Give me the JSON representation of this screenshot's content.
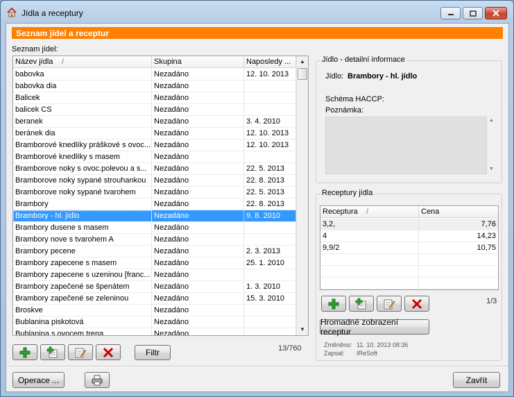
{
  "window": {
    "title": "Jídla a receptury",
    "colors": {
      "accent": "#ff8000",
      "selection": "#3399ff",
      "delete": "#cc0000",
      "add": "#2ea02e"
    }
  },
  "header": {
    "title": "Seznam jídel a receptur"
  },
  "food_list": {
    "label": "Seznam jídel:",
    "columns": [
      "Název jídla",
      "Skupina",
      "Naposledy ..."
    ],
    "rows": [
      [
        "babovka",
        "Nezadáno",
        "12. 10. 2013"
      ],
      [
        "babovka dia",
        "Nezadáno",
        ""
      ],
      [
        "Balicek",
        "Nezadáno",
        ""
      ],
      [
        "balicek CS",
        "Nezadáno",
        ""
      ],
      [
        "beranek",
        "Nezadáno",
        "3. 4. 2010"
      ],
      [
        "beránek dia",
        "Nezadáno",
        "12. 10. 2013"
      ],
      [
        "Bramborové knedlíky práškové s ovoc...",
        "Nezadáno",
        "12. 10. 2013"
      ],
      [
        "Bramborové knedlíky s masem",
        "Nezadáno",
        ""
      ],
      [
        "Bramborove noky  s ovoc.polevou a s...",
        "Nezadáno",
        "22. 5. 2013"
      ],
      [
        "Bramborove noky sypané strouhankou",
        "Nezadáno",
        "22. 8. 2013"
      ],
      [
        "Bramborove noky sypané tvarohem",
        "Nezadáno",
        "22. 5. 2013"
      ],
      [
        "Brambory",
        "Nezadáno",
        "22. 8. 2013"
      ],
      [
        "Brambory - hl. jídlo",
        "Nezadáno",
        "9. 8. 2010"
      ],
      [
        "Brambory dusene s masem",
        "Nezadáno",
        ""
      ],
      [
        "Brambory nove s tvarohem A",
        "Nezadáno",
        ""
      ],
      [
        "Brambory pecene",
        "Nezadáno",
        "2. 3. 2013"
      ],
      [
        "Brambory zapecene s masem",
        "Nezadáno",
        "25. 1. 2010"
      ],
      [
        "Brambory zapecene s uzeninou [franc...",
        "Nezadáno",
        ""
      ],
      [
        "Brambory zapečené se špenátem",
        "Nezadáno",
        "1. 3. 2010"
      ],
      [
        "Brambory zapečené se zeleninou",
        "Nezadáno",
        "15. 3. 2010"
      ],
      [
        "Broskve",
        "Nezadáno",
        ""
      ],
      [
        "Bublanina piskotová",
        "Nezadáno",
        ""
      ],
      [
        "Bublanina s ovocem trena",
        "Nezadáno",
        ""
      ]
    ],
    "selected_index": 12,
    "counter": "13/760",
    "filter_label": "Filtr"
  },
  "detail": {
    "group_title": "Jídlo - detailní informace",
    "food_label": "Jídlo:",
    "food_value": "Brambory - hl. jídlo",
    "haccp_label": "Schéma HACCP:",
    "note_label": "Poznámka:"
  },
  "recipes": {
    "group_title": "Receptury jídla",
    "columns": [
      "Receptura",
      "Cena"
    ],
    "rows": [
      [
        "3,2,",
        "7,76"
      ],
      [
        "4",
        "14,23"
      ],
      [
        "9,9/2",
        "10,75"
      ]
    ],
    "counter": "1/3",
    "bulk_button": "Hromadné zobrazení receptur",
    "changed_label": "Změněno:",
    "changed_value": "11. 10. 2013 08:36",
    "author_label": "Zapsal:",
    "author_value": "IReSoft"
  },
  "footer": {
    "operations_label": "Operace ...",
    "close_label": "Zavřít"
  },
  "icons": [
    "add-icon",
    "add-copy-icon",
    "edit-icon",
    "delete-icon",
    "printer-icon",
    "minimize-icon",
    "maximize-icon",
    "close-icon",
    "sort-arrow-icon"
  ]
}
